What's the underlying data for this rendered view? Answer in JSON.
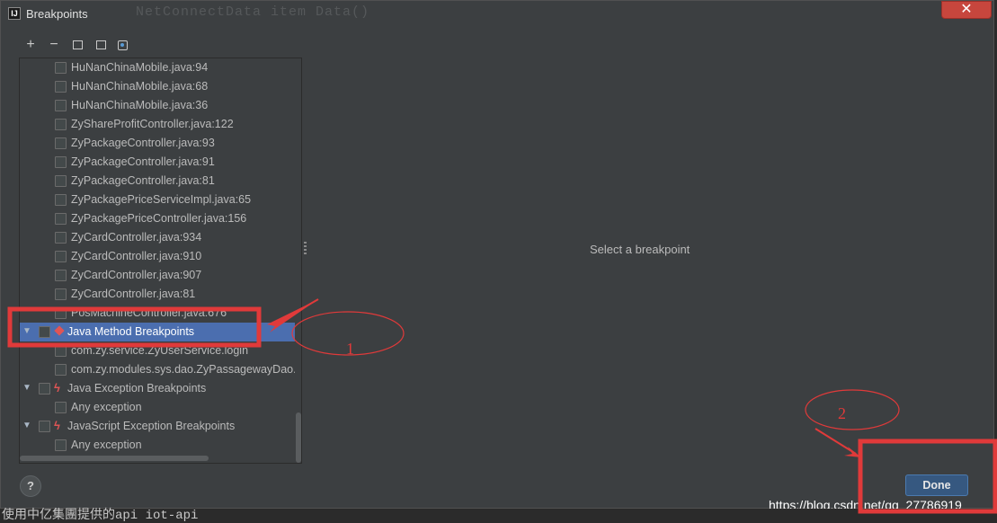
{
  "window": {
    "title": "Breakpoints",
    "app_icon": "IJ",
    "background_code": "NetConnectData item Data()",
    "close_glyph": "✕"
  },
  "toolbar": {
    "add_glyph": "+",
    "remove_glyph": "−"
  },
  "tree": {
    "rows": [
      {
        "label": "HuNanChinaMobile.java:94",
        "kind": "item"
      },
      {
        "label": "HuNanChinaMobile.java:68",
        "kind": "item"
      },
      {
        "label": "HuNanChinaMobile.java:36",
        "kind": "item"
      },
      {
        "label": "ZyShareProfitController.java:122",
        "kind": "item"
      },
      {
        "label": "ZyPackageController.java:93",
        "kind": "item"
      },
      {
        "label": "ZyPackageController.java:91",
        "kind": "item"
      },
      {
        "label": "ZyPackageController.java:81",
        "kind": "item"
      },
      {
        "label": "ZyPackagePriceServiceImpl.java:65",
        "kind": "item"
      },
      {
        "label": "ZyPackagePriceController.java:156",
        "kind": "item"
      },
      {
        "label": "ZyCardController.java:934",
        "kind": "item"
      },
      {
        "label": "ZyCardController.java:910",
        "kind": "item"
      },
      {
        "label": "ZyCardController.java:907",
        "kind": "item"
      },
      {
        "label": "ZyCardController.java:81",
        "kind": "item"
      },
      {
        "label": "PosMachineController.java:676",
        "kind": "item"
      },
      {
        "label": "Java Method Breakpoints",
        "kind": "group",
        "icon": "diamond",
        "selected": true
      },
      {
        "label": "com.zy.service.ZyUserService.login",
        "kind": "item"
      },
      {
        "label": "com.zy.modules.sys.dao.ZyPassagewayDao.c",
        "kind": "item"
      },
      {
        "label": "Java Exception Breakpoints",
        "kind": "group",
        "icon": "bolt"
      },
      {
        "label": "Any exception",
        "kind": "item"
      },
      {
        "label": "JavaScript Exception Breakpoints",
        "kind": "group",
        "icon": "bolt"
      },
      {
        "label": "Any exception",
        "kind": "item"
      }
    ]
  },
  "detail": {
    "empty_text": "Select a breakpoint"
  },
  "footer": {
    "help_label": "?",
    "done_label": "Done",
    "watermark": "https://blog.csdn.net/qq_27786919",
    "bottom_text": "使用中亿集團提供的api iot-api"
  },
  "annotations": {
    "label_1": "1",
    "label_2": "2",
    "color": "#e03a3a"
  }
}
